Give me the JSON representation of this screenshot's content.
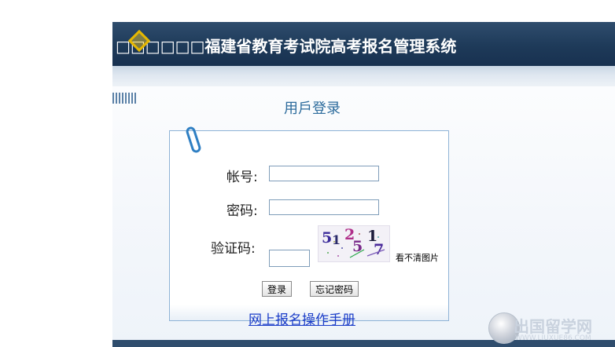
{
  "header": {
    "title": "□□□□□□福建省教育考试院高考报名管理系统"
  },
  "login": {
    "heading": "用戶登录",
    "account_label": "帐号:",
    "account_value": "",
    "password_label": "密码:",
    "password_value": "",
    "captcha_label": "验证码:",
    "captcha_value": "",
    "captcha_chars": [
      "5",
      "1",
      "2",
      "5",
      "1",
      "7"
    ],
    "captcha_refresh": "看不清图片",
    "login_button": "登录",
    "forgot_button": "忘记密码",
    "manual_link": "网上报名操作手册"
  },
  "watermark": {
    "text": "出国留学网",
    "url": "WWW.LIUXUE86.COM"
  },
  "colors": {
    "header_bg": "#1e3a59",
    "heading": "#2c6b9c",
    "link": "#1a3cc8",
    "box_border": "#8fb3d6"
  }
}
